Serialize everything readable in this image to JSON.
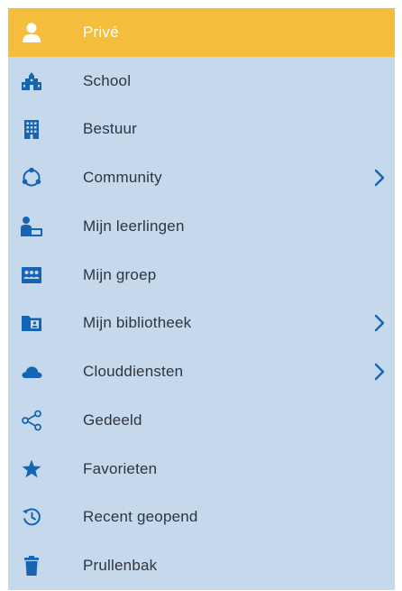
{
  "colors": {
    "panel_bg": "#c6d9ec",
    "active_bg": "#f4be3c",
    "icon": "#1565b4",
    "text": "#2e3440",
    "active_text": "#ffffff"
  },
  "nav": {
    "items": [
      {
        "label": "Privé",
        "icon": "user-icon",
        "active": true,
        "has_submenu": false
      },
      {
        "label": "School",
        "icon": "school-building-icon",
        "active": false,
        "has_submenu": false
      },
      {
        "label": "Bestuur",
        "icon": "office-building-icon",
        "active": false,
        "has_submenu": false
      },
      {
        "label": "Community",
        "icon": "community-circle-icon",
        "active": false,
        "has_submenu": true
      },
      {
        "label": "Mijn leerlingen",
        "icon": "student-desk-icon",
        "active": false,
        "has_submenu": false
      },
      {
        "label": "Mijn groep",
        "icon": "group-board-icon",
        "active": false,
        "has_submenu": false
      },
      {
        "label": "Mijn bibliotheek",
        "icon": "library-folder-icon",
        "active": false,
        "has_submenu": true
      },
      {
        "label": "Clouddiensten",
        "icon": "cloud-icon",
        "active": false,
        "has_submenu": true
      },
      {
        "label": "Gedeeld",
        "icon": "share-icon",
        "active": false,
        "has_submenu": false
      },
      {
        "label": "Favorieten",
        "icon": "star-icon",
        "active": false,
        "has_submenu": false
      },
      {
        "label": "Recent geopend",
        "icon": "history-clock-icon",
        "active": false,
        "has_submenu": false
      },
      {
        "label": "Prullenbak",
        "icon": "trash-icon",
        "active": false,
        "has_submenu": false
      }
    ]
  }
}
